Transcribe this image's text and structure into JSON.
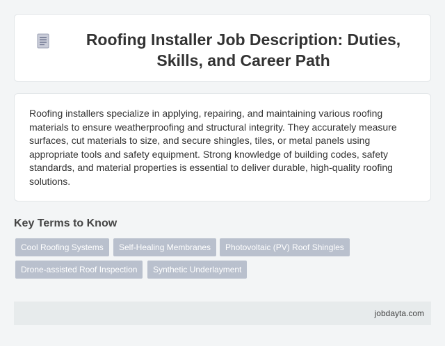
{
  "header": {
    "icon": "document-icon",
    "title": "Roofing Installer Job Description: Duties, Skills, and Career Path"
  },
  "description": "Roofing installers specialize in applying, repairing, and maintaining various roofing materials to ensure weatherproofing and structural integrity. They accurately measure surfaces, cut materials to size, and secure shingles, tiles, or metal panels using appropriate tools and safety equipment. Strong knowledge of building codes, safety standards, and material properties is essential to deliver durable, high-quality roofing solutions.",
  "key_terms": {
    "title": "Key Terms to Know",
    "tags": [
      "Cool Roofing Systems",
      "Self-Healing Membranes",
      "Photovoltaic (PV) Roof Shingles",
      "Drone-assisted Roof Inspection",
      "Synthetic Underlayment"
    ]
  },
  "footer": {
    "site": "jobdayta.com"
  },
  "colors": {
    "tag_background": "#b9c0cd",
    "page_background": "#f3f5f6",
    "footer_background": "#e7ebec"
  }
}
